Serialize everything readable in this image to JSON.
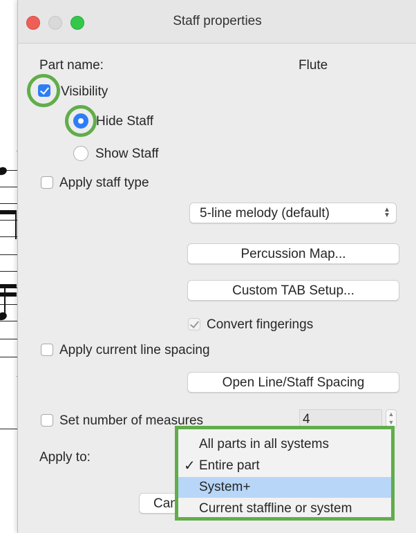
{
  "window": {
    "title": "Staff properties"
  },
  "part_name": {
    "label": "Part name:",
    "value": "Flute"
  },
  "visibility": {
    "label": "Visibility",
    "checked": true
  },
  "radio_hide": {
    "label": "Hide Staff",
    "selected": true
  },
  "radio_show": {
    "label": "Show Staff",
    "selected": false
  },
  "apply_staff_type": {
    "label": "Apply staff type",
    "checked": false
  },
  "staff_type_select": {
    "value": "5-line melody (default)"
  },
  "percussion_map_button": {
    "label": "Percussion Map..."
  },
  "custom_tab_button": {
    "label": "Custom TAB Setup..."
  },
  "convert_fingerings": {
    "label": "Convert fingerings",
    "checked": true,
    "disabled": true
  },
  "apply_line_spacing": {
    "label": "Apply current line spacing",
    "checked": false
  },
  "open_spacing_button": {
    "label": "Open Line/Staff Spacing"
  },
  "set_measures": {
    "label": "Set number of measures",
    "checked": false,
    "value": "4"
  },
  "apply_to": {
    "label": "Apply to:"
  },
  "cancel_button": {
    "label": "Cancel"
  },
  "apply_menu": {
    "items": [
      {
        "label": "All parts in all systems",
        "checked": false,
        "highlighted": false
      },
      {
        "label": "Entire part",
        "checked": true,
        "highlighted": false
      },
      {
        "label": "System+",
        "checked": false,
        "highlighted": true
      },
      {
        "label": "Current staffline or system",
        "checked": false,
        "highlighted": false
      }
    ]
  },
  "colors": {
    "highlight_ring": "#61ad4b",
    "accent": "#2d7df6",
    "menu_highlight": "#b8d6f8"
  }
}
